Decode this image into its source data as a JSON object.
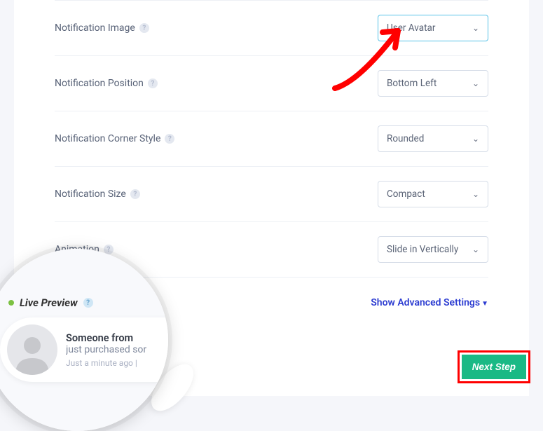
{
  "fields": [
    {
      "label": "Notification Image",
      "value": "User Avatar",
      "active": true
    },
    {
      "label": "Notification Position",
      "value": "Bottom Left",
      "active": false
    },
    {
      "label": "Notification Corner Style",
      "value": "Rounded",
      "active": false
    },
    {
      "label": "Notification Size",
      "value": "Compact",
      "active": false
    },
    {
      "label": "Animation",
      "value": "Slide in Vertically",
      "active": false
    }
  ],
  "advanced_label": "Show Advanced Settings",
  "next_button": "Next Step",
  "preview": {
    "title": "Live Preview",
    "notif_title": "Someone from",
    "notif_sub": "just purchased sor",
    "notif_time": "Just a minute ago |"
  }
}
